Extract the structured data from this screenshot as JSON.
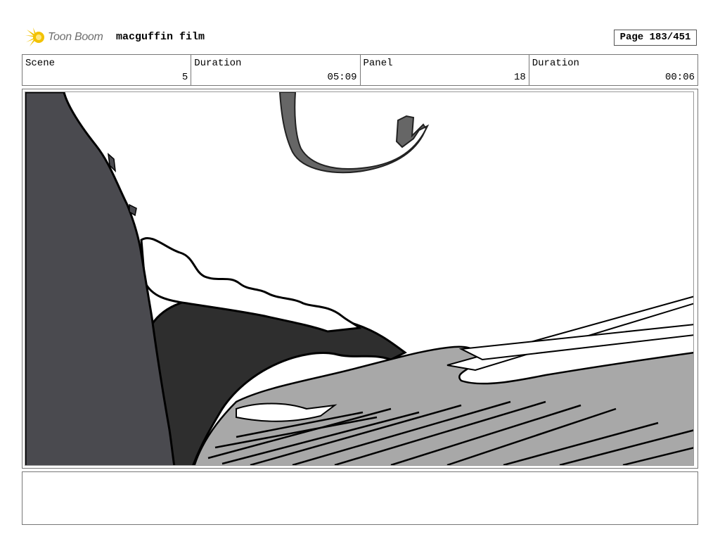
{
  "header": {
    "logo_text": "Toon Boom",
    "project_title": "macguffin film",
    "page_label": "Page 183/451"
  },
  "info": {
    "scene_label": "Scene",
    "scene_value": "5",
    "scene_duration_label": "Duration",
    "scene_duration_value": "05:09",
    "panel_label": "Panel",
    "panel_value": "18",
    "panel_duration_label": "Duration",
    "panel_duration_value": "00:06"
  },
  "colors": {
    "cliff": "#4a4a4f",
    "rock_mid": "#a8a8a8",
    "tail": "#666666",
    "logo_star": "#f2c200"
  },
  "notes": {
    "text": ""
  }
}
